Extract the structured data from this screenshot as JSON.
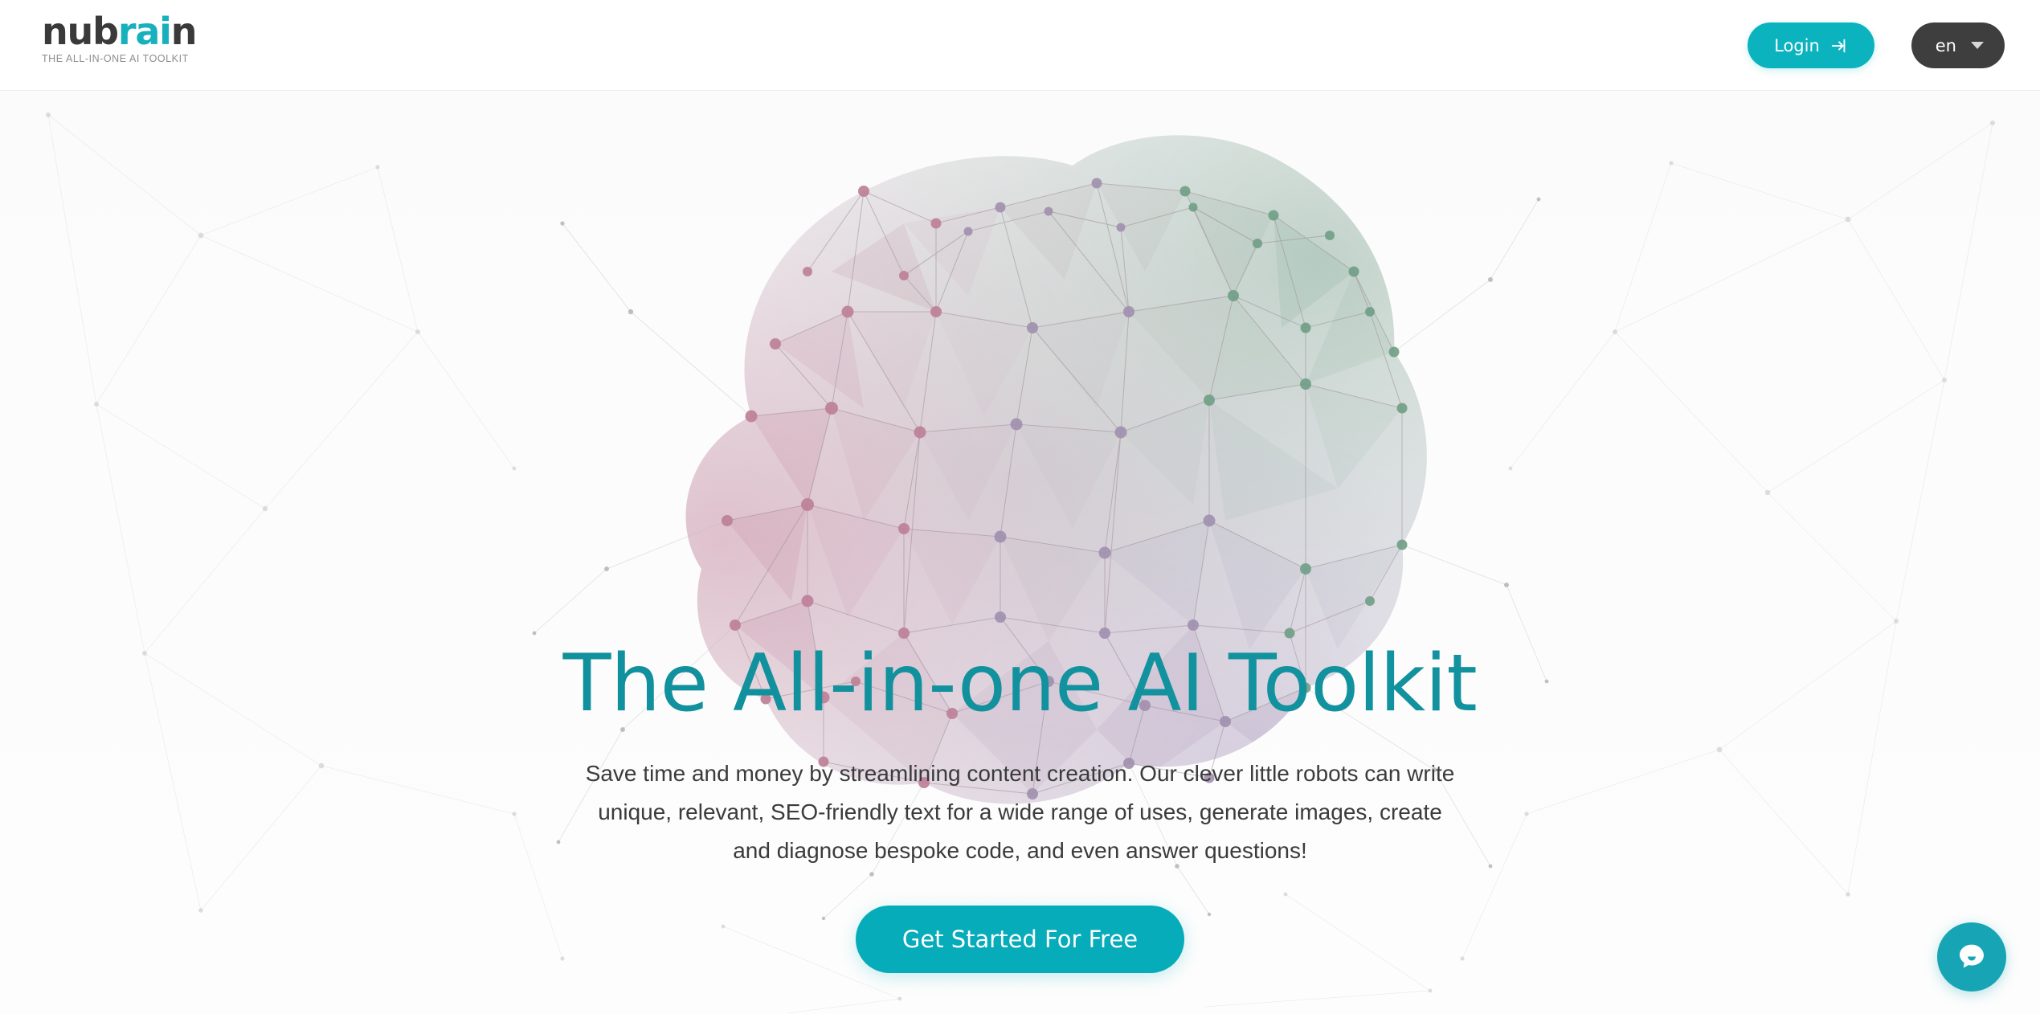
{
  "header": {
    "logo": {
      "text_dark_1": "nub",
      "text_accent": "rai",
      "text_dark_2": "n",
      "tagline": "THE ALL-IN-ONE AI TOOLKIT"
    },
    "login_label": "Login",
    "login_icon": "login-arrow-icon",
    "lang_value": "en",
    "lang_caret_icon": "chevron-down-icon"
  },
  "hero": {
    "title": "The All-in-one AI Toolkit",
    "subtitle": "Save time and money by streamlining content creation. Our clever little robots can write unique, relevant, SEO-friendly text for a wide range of uses, generate images, create and diagnose bespoke code, and even answer questions!",
    "cta_label": "Get Started For Free",
    "background_art": "low-poly-brain-network-illustration"
  },
  "chat": {
    "icon": "chat-bubble-icon",
    "aria_label": "Open chat"
  },
  "colors": {
    "accent_teal": "#0bb3bf",
    "cta_teal": "#06acb9",
    "heading_teal": "#12939f",
    "logo_accent": "#17b0bd",
    "logo_dark": "#3a3a3a",
    "lang_dark": "#3e3e3e",
    "chat_teal": "#17a5b5",
    "body_text": "#3b3b3b",
    "tagline_gray": "#8c8c8c",
    "page_background": "#fdfdfd",
    "brain_pink": "#c98ea5",
    "brain_green": "#7fa992",
    "brain_mauve": "#a898bb"
  }
}
